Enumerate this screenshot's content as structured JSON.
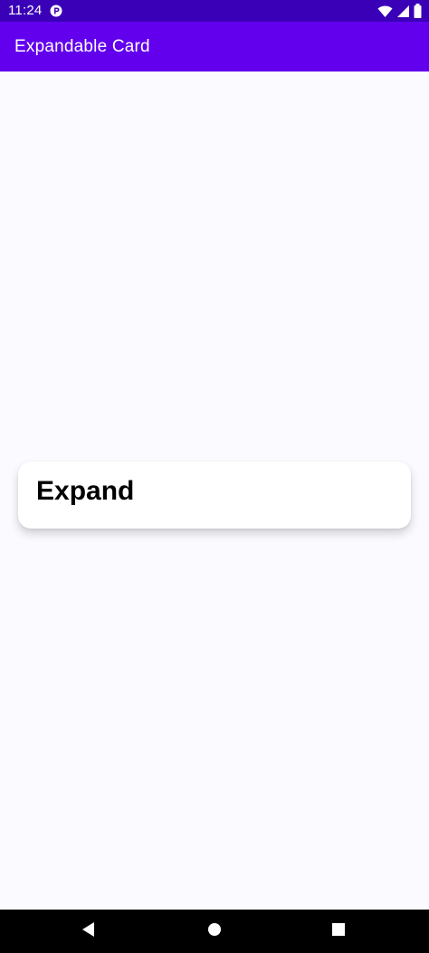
{
  "status_bar": {
    "time": "11:24",
    "app_icon": "p-notification-icon",
    "wifi_icon": "wifi-icon",
    "signal_icon": "signal-icon",
    "battery_icon": "battery-icon"
  },
  "app_bar": {
    "title": "Expandable Card"
  },
  "card": {
    "title": "Expand"
  },
  "nav_bar": {
    "back_icon": "back-icon",
    "home_icon": "home-icon",
    "recents_icon": "recents-icon"
  },
  "colors": {
    "status_bar_bg": "#3a00b8",
    "app_bar_bg": "#6200ee",
    "background": "#fbfafe",
    "card_bg": "#ffffff",
    "nav_bar_bg": "#000000"
  }
}
